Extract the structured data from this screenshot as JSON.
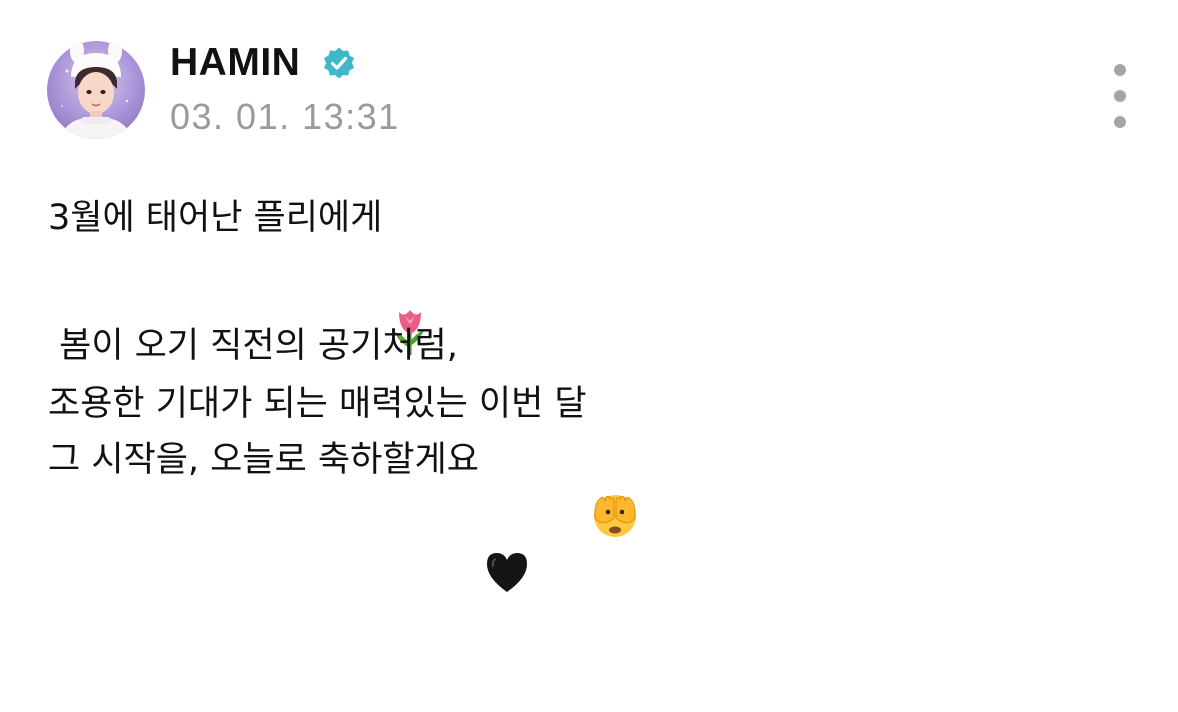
{
  "post": {
    "author_name": "HAMIN",
    "verified_icon": "verified-badge-icon",
    "timestamp": "03. 01. 13:31",
    "more_icon": "more-vertical-icon",
    "lines": [
      {
        "text": "3월에 태어난 플리에게",
        "emoji": "tulip-emoji"
      },
      {
        "text": " 봄이 오기 직전의 공기처럼,",
        "emoji": null
      },
      {
        "text": "조용한 기대가 되는 매력있는 이번 달",
        "emoji": "face-with-hands-over-eyes-emoji"
      },
      {
        "text": "그 시작을, 오늘로 축하할게요",
        "emoji": "black-heart-emoji"
      }
    ]
  },
  "colors": {
    "text": "#111111",
    "timestamp": "#9a9a9a",
    "verified": "#3fb8c9",
    "more_dots": "#a5a5a5",
    "background": "#ffffff"
  }
}
